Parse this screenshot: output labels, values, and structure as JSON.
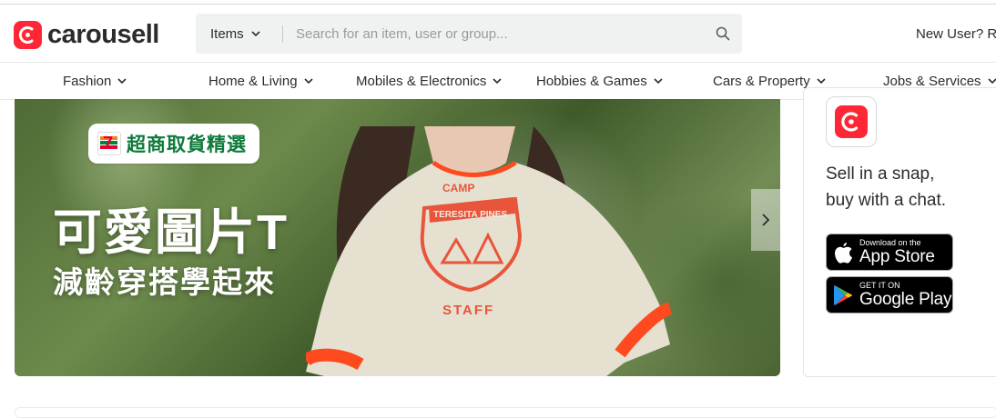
{
  "header": {
    "logo_text": "carousell",
    "search": {
      "category_label": "Items",
      "placeholder": "Search for an item, user or group..."
    },
    "new_user_text": "New User? R"
  },
  "categories": [
    {
      "label": "Fashion"
    },
    {
      "label": "Home & Living"
    },
    {
      "label": "Mobiles & Electronics"
    },
    {
      "label": "Hobbies & Games"
    },
    {
      "label": "Cars & Property"
    },
    {
      "label": "Jobs & Services"
    }
  ],
  "banner": {
    "badge_text": "超商取貨精選",
    "headline": "可愛圖片T",
    "subheadline": "減齡穿搭學起來",
    "shirt_print": {
      "top": "CAMP",
      "arc": "TERESITA PINES",
      "bottom": "STAFF"
    }
  },
  "app_card": {
    "tagline_line1": "Sell in a snap,",
    "tagline_line2": "buy with a chat.",
    "app_store": {
      "small": "Download on the",
      "big": "App Store"
    },
    "google_play": {
      "small": "GET IT ON",
      "big": "Google Play"
    }
  },
  "colors": {
    "brand_red": "#ff2636",
    "text": "#2c2c2d",
    "search_bg": "#f0f1f1",
    "badge_green": "#0d7a3a",
    "shirt_trim": "#ff4a1f"
  },
  "icons": [
    "carousell-logo-icon",
    "chevron-down-icon",
    "search-icon",
    "chevron-right-icon",
    "seven-eleven-icon",
    "apple-icon",
    "google-play-icon"
  ]
}
